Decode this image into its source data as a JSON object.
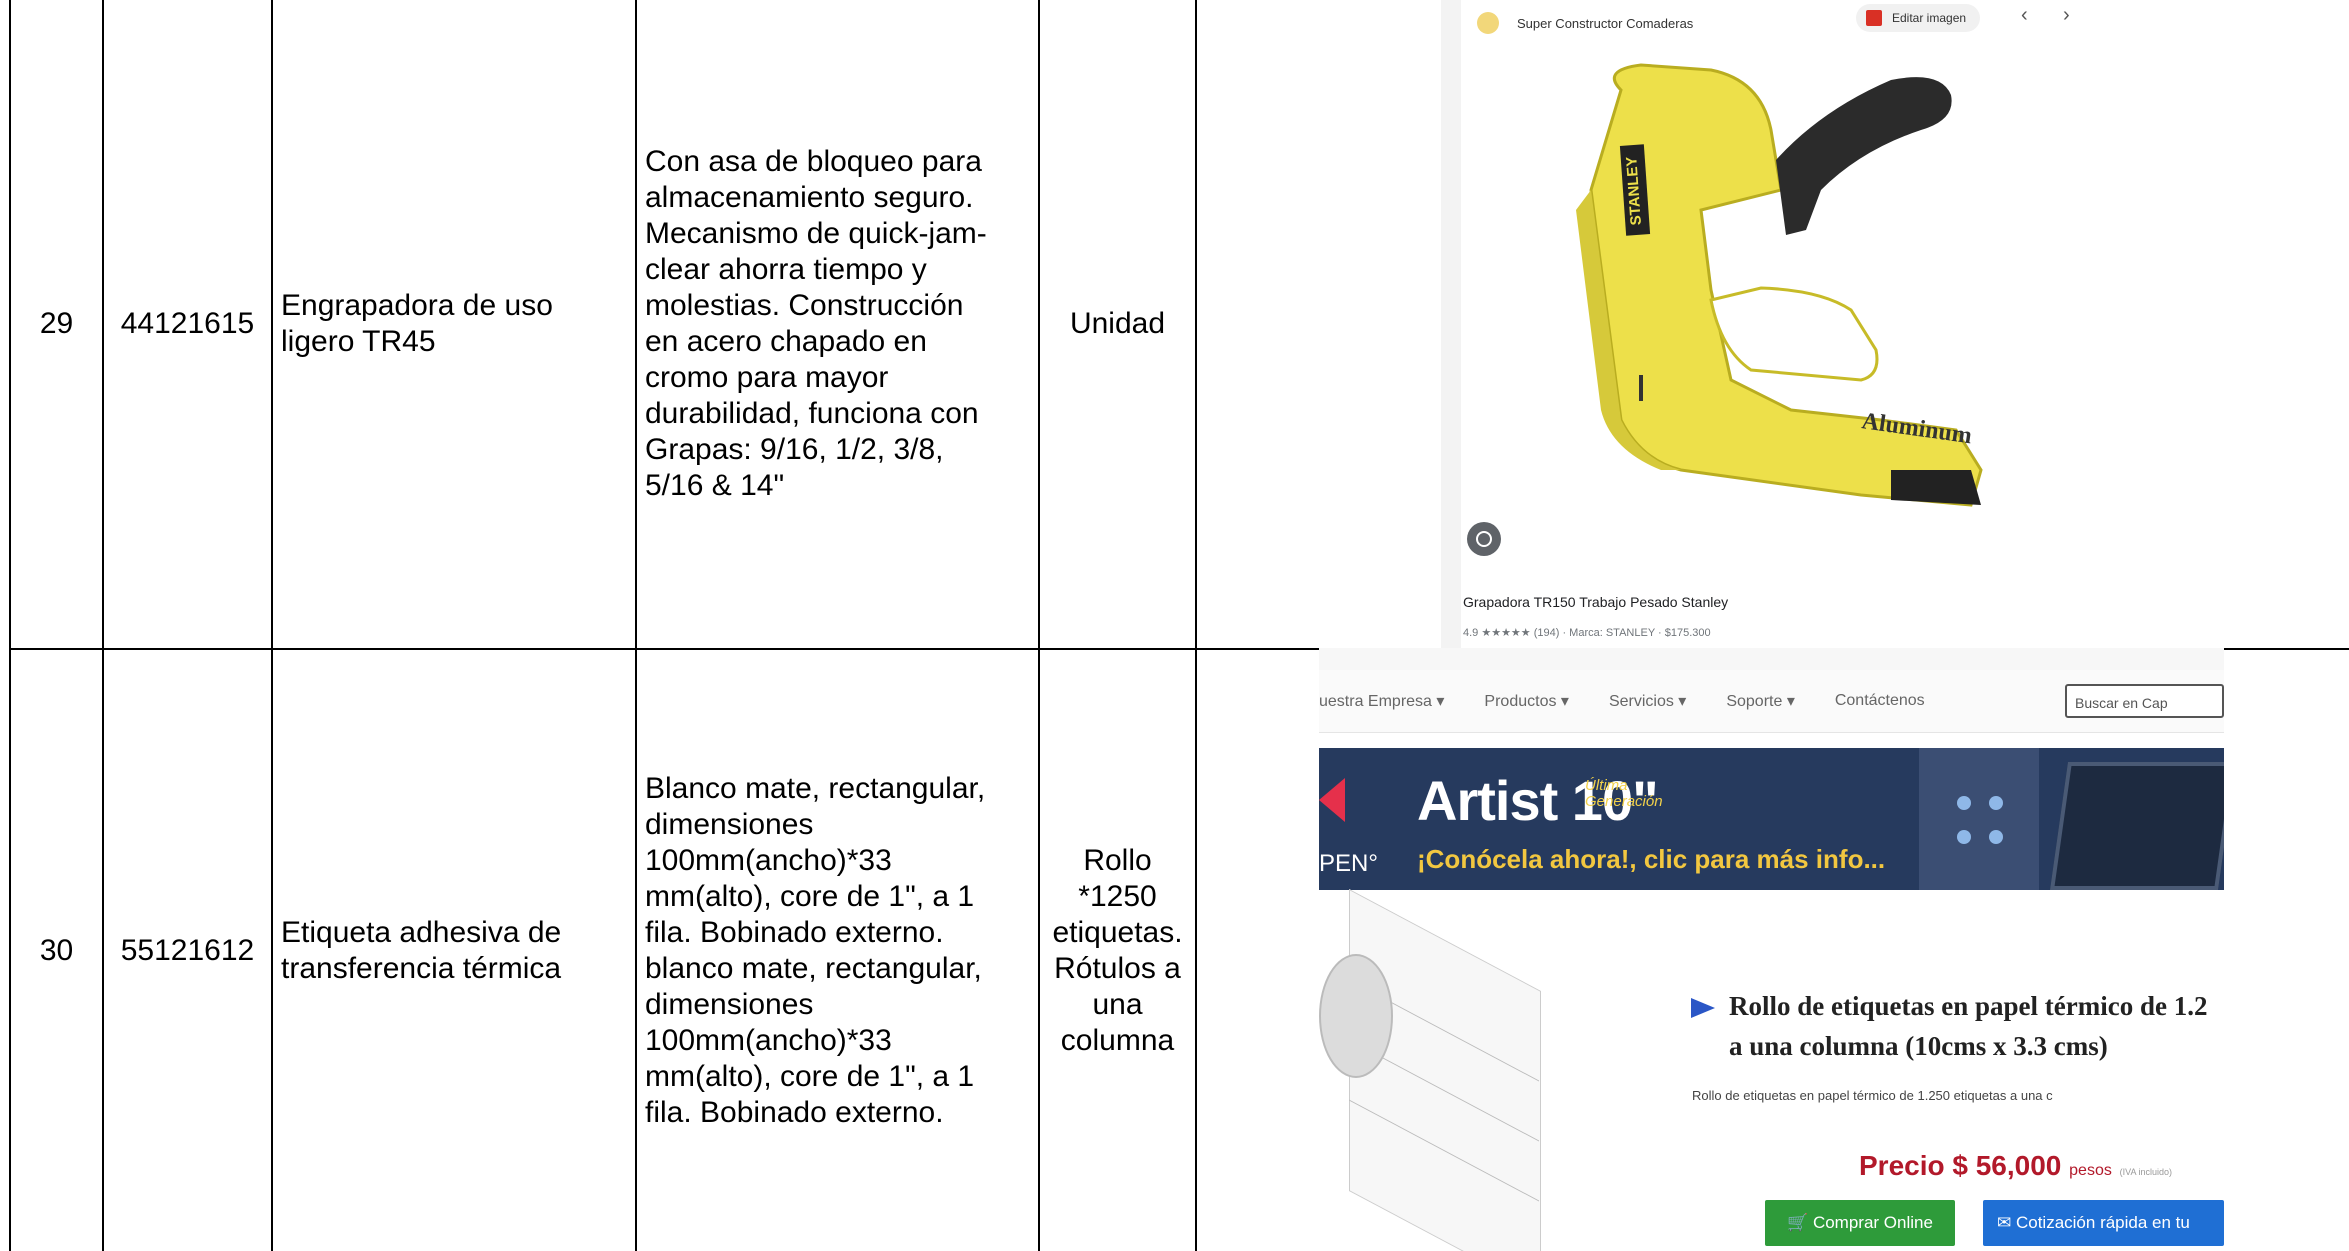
{
  "rows": [
    {
      "num": "29",
      "code": "44121615",
      "name": "Engrapadora de uso\nligero TR45",
      "description": "Con asa de bloqueo para\nalmacenamiento seguro.\nMecanismo de quick-jam-\nclear ahorra tiempo y\nmolestias. Construcción\nen acero chapado en\ncromo para mayor\ndurabilidad, funciona con\nGrapas: 9/16, 1/2, 3/8,\n5/16 & 14\"",
      "unit": "Unidad"
    },
    {
      "num": "30",
      "code": "55121612",
      "name": "Etiqueta adhesiva de\ntransferencia térmica",
      "description": "Blanco mate, rectangular,\ndimensiones\n100mm(ancho)*33\nmm(alto), core de 1\", a 1\nfila. Bobinado externo.\nblanco mate, rectangular,\ndimensiones\n100mm(ancho)*33\nmm(alto), core de 1\", a 1\nfila. Bobinado externo.",
      "unit": "Rollo\n*1250\netiquetas.\nRótulos a\nuna\ncolumna"
    }
  ],
  "shot1": {
    "site": "Super Constructor Comaderas",
    "edit_label": "Editar imagen",
    "prev": "‹",
    "next": "›",
    "brand_side": "STANLEY",
    "brand_body": "Aluminum",
    "product_title": "Grapadora TR150 Trabajo Pesado Stanley",
    "meta": "4.9 ★★★★★ (194) · Marca: STANLEY · $175.300"
  },
  "shot2": {
    "nav_items": [
      "uestra Empresa ▾",
      "Productos ▾",
      "Servicios ▾",
      "Soporte ▾",
      "Contáctenos"
    ],
    "search_placeholder": "Buscar en Cap",
    "banner_title": "Artist 10\"",
    "banner_tag": "Última\nGeneración",
    "banner_sub": "¡Conócela ahora!, clic para más info...",
    "banner_pen": "PEN°",
    "heading": "Rollo de etiquetas en papel térmico de 1.2\na una columna (10cms x 3.3 cms)",
    "desc": "Rollo de etiquetas en papel térmico de 1.250 etiquetas a una c",
    "price_label": "Precio $ 56,000",
    "price_unit": "pesos",
    "price_iva": "(IVA incluido)",
    "buy_label": "Comprar Online",
    "quote_label": "Cotización rápida en tu"
  }
}
